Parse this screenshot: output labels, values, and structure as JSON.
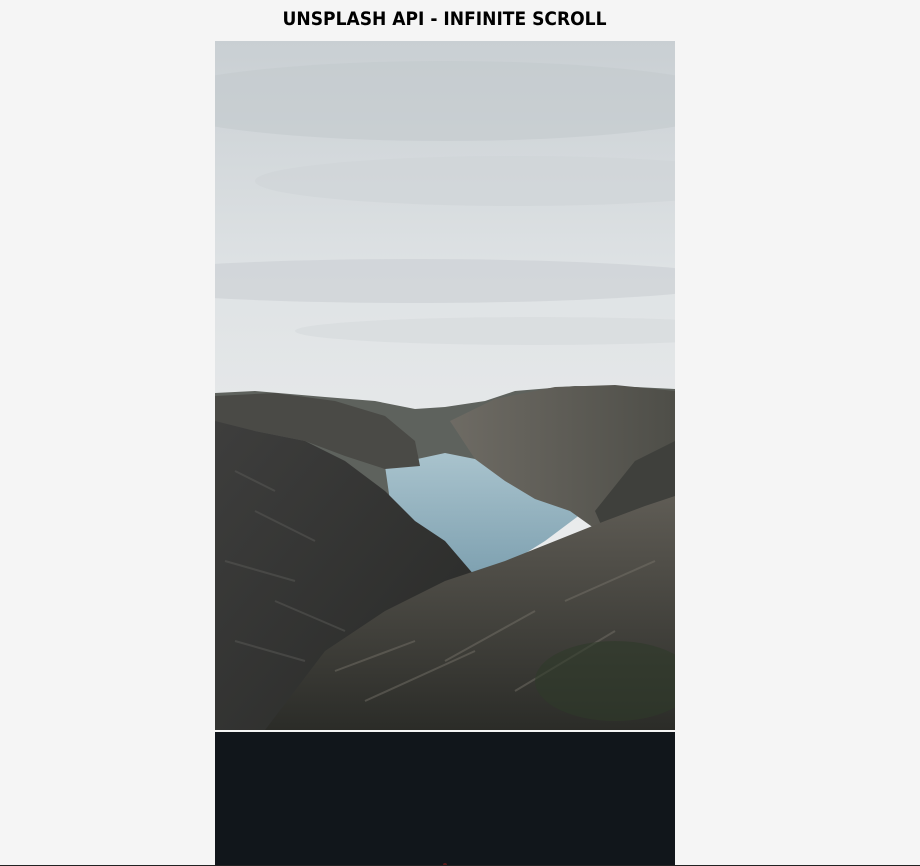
{
  "header": {
    "title": "UNSPLASH API - INFINITE SCROLL"
  },
  "gallery": {
    "photos": [
      {
        "icon": "fjord-landscape-photo",
        "theme_colors": [
          "#d6dadd",
          "#5a5f5e",
          "#8ab0bf",
          "#2a2c2c"
        ]
      },
      {
        "icon": "dark-night-photo",
        "theme_colors": [
          "#11161b"
        ]
      }
    ]
  },
  "colors": {
    "background": "#f5f5f5",
    "title": "#000000"
  }
}
